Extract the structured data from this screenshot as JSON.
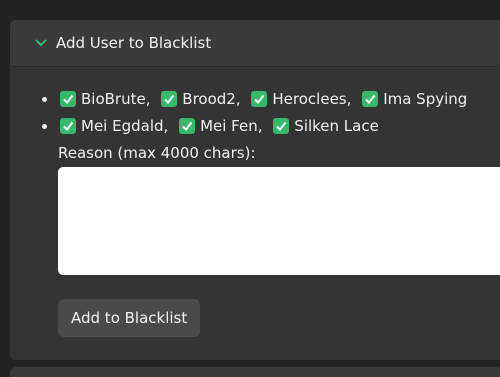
{
  "panel": {
    "title": "Add User to Blacklist",
    "chevron_icon": "chevron-down-icon",
    "accent_color": "#38b86a"
  },
  "users": {
    "line1": [
      {
        "name": "BioBrute",
        "sep": ","
      },
      {
        "name": "Brood2",
        "sep": ","
      },
      {
        "name": "Heroclees",
        "sep": ","
      },
      {
        "name": "Ima Spying",
        "sep": ""
      }
    ],
    "line2": [
      {
        "name": "Mei Egdald",
        "sep": ","
      },
      {
        "name": "Mei Fen",
        "sep": ","
      },
      {
        "name": "Silken Lace",
        "sep": ""
      }
    ]
  },
  "reason": {
    "label": "Reason (max 4000 chars):",
    "value": ""
  },
  "actions": {
    "add_label": "Add to Blacklist"
  }
}
